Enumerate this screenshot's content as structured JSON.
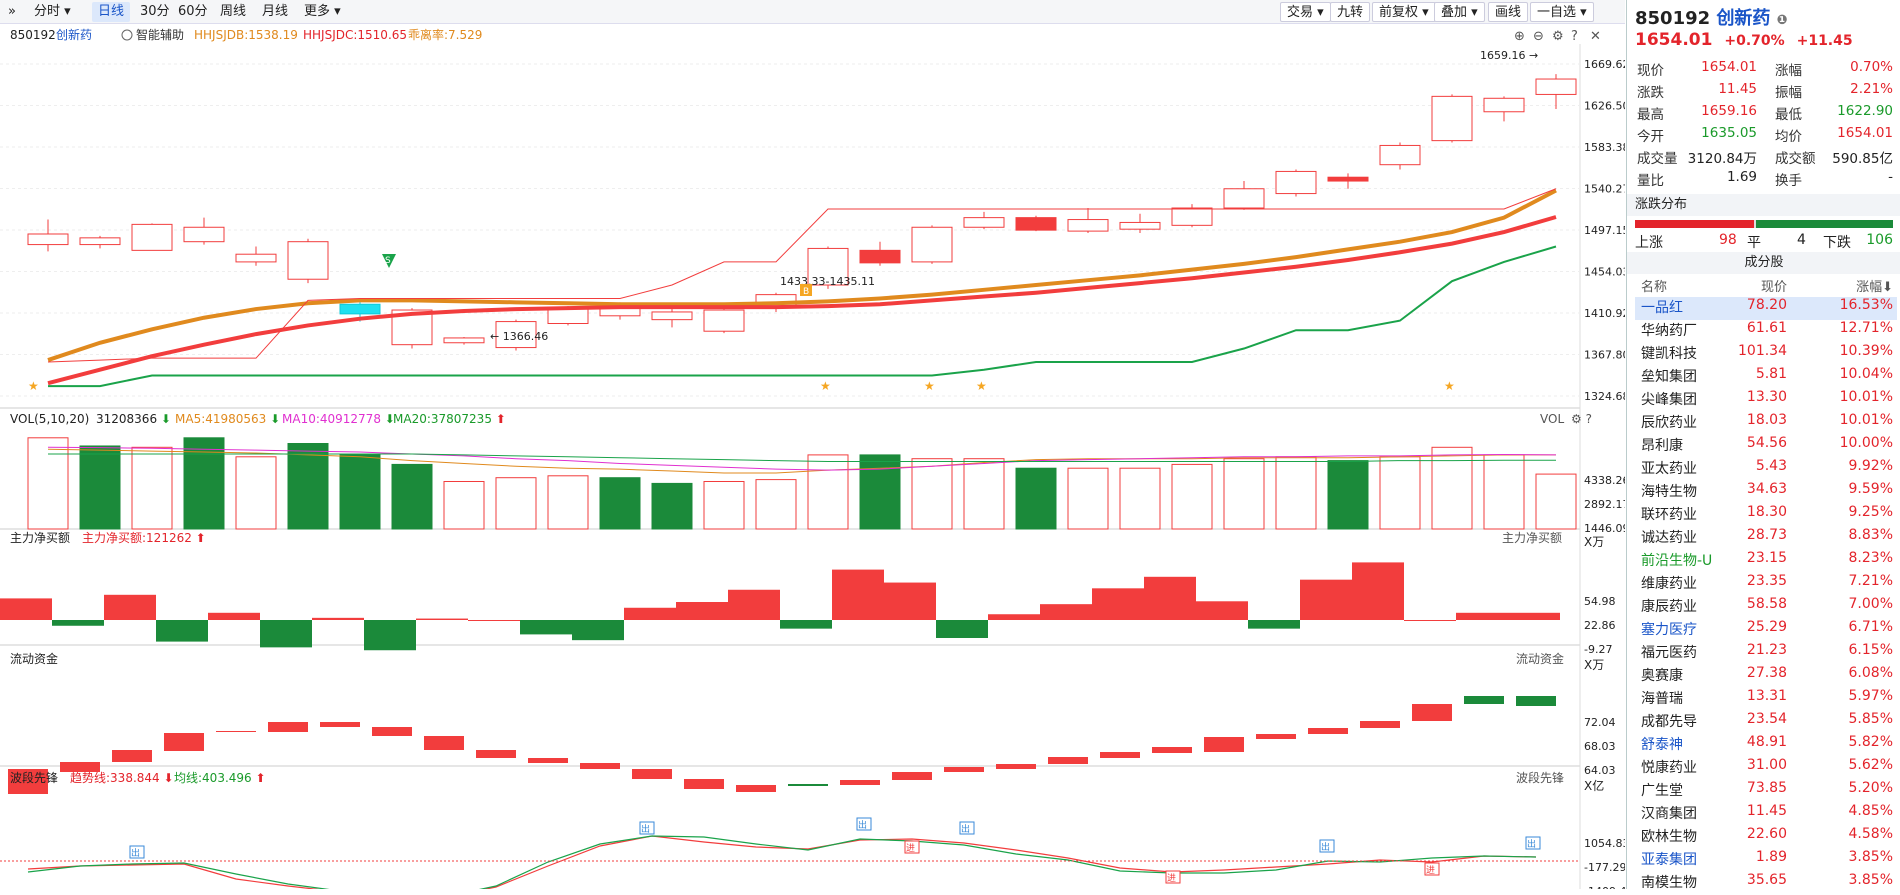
{
  "toolbar": {
    "items": [
      "»",
      "分时",
      "日线",
      "30分",
      "60分",
      "周线",
      "月线",
      "更多"
    ],
    "right": [
      "交易",
      "九转",
      "前复权",
      "叠加",
      "画线",
      "一自选"
    ]
  },
  "chart": {
    "code": "850192",
    "name": "创新药",
    "assist": "智能辅助",
    "ind1": "HHJSJDB:1538.19",
    "ind2": "HHJSJDC:1510.65",
    "ind3": "乖离率:7.529",
    "price_axis": [
      "1669.62",
      "1626.50",
      "1583.38",
      "1540.27",
      "1497.15",
      "1454.03",
      "1410.92",
      "1367.80",
      "1324.68"
    ],
    "annot_high": "1659.16",
    "annot_low": "1366.46",
    "annot_mid": "1433.33-1435.11"
  },
  "vol": {
    "title": "VOL(5,10,20)",
    "v": "31208366",
    "ma5": "MA5:41980563",
    "ma10": "MA10:40912778",
    "ma20": "MA20:37807235",
    "right": "VOL",
    "axis": [
      "4338.26",
      "2892.17",
      "1446.09"
    ],
    "unit": "X万"
  },
  "zl": {
    "title": "主力净买额",
    "val": "主力净买额:121262",
    "right": "主力净买额",
    "axis": [
      "54.98",
      "22.86",
      "-9.27"
    ],
    "unit": "X万"
  },
  "ld": {
    "title": "流动资金",
    "right": "流动资金",
    "axis": [
      "72.04",
      "68.03",
      "64.03"
    ],
    "unit": "X亿"
  },
  "bd": {
    "title": "波段先锋",
    "trend": "趋势线:338.844",
    "avg": "均线:403.496",
    "right": "波段先锋",
    "axis": [
      "1054.83",
      "-177.29",
      "-1409.40"
    ],
    "in": "进",
    "out": "出"
  },
  "quote": {
    "code": "850192",
    "name": "创新药",
    "price": "1654.01",
    "pct": "+0.70%",
    "chg": "+11.45",
    "rows": [
      [
        "现价",
        "1654.01",
        "涨幅",
        "0.70%"
      ],
      [
        "涨跌",
        "11.45",
        "振幅",
        "2.21%"
      ],
      [
        "最高",
        "1659.16",
        "最低",
        "1622.90"
      ],
      [
        "今开",
        "1635.05",
        "均价",
        "1654.01"
      ],
      [
        "成交量",
        "3120.84万",
        "成交额",
        "590.85亿"
      ],
      [
        "量比",
        "1.69",
        "换手",
        "-"
      ]
    ],
    "dist_title": "涨跌分布",
    "up_label": "上涨",
    "up": "98",
    "flat_label": "平",
    "flat": "4",
    "down_label": "下跌",
    "down": "106",
    "cf_title": "成分股",
    "col_name": "名称",
    "col_price": "现价",
    "col_pct": "涨幅"
  },
  "stocks": [
    [
      "一品红",
      "78.20",
      "16.53%"
    ],
    [
      "华纳药厂",
      "61.61",
      "12.71%"
    ],
    [
      "键凯科技",
      "101.34",
      "10.39%"
    ],
    [
      "垒知集团",
      "5.81",
      "10.04%"
    ],
    [
      "尖峰集团",
      "13.30",
      "10.01%"
    ],
    [
      "辰欣药业",
      "18.03",
      "10.01%"
    ],
    [
      "昂利康",
      "54.56",
      "10.00%"
    ],
    [
      "亚太药业",
      "5.43",
      "9.92%"
    ],
    [
      "海特生物",
      "34.63",
      "9.59%"
    ],
    [
      "联环药业",
      "18.30",
      "9.25%"
    ],
    [
      "诚达药业",
      "28.73",
      "8.83%"
    ],
    [
      "前沿生物-U",
      "23.15",
      "8.23%"
    ],
    [
      "维康药业",
      "23.35",
      "7.21%"
    ],
    [
      "康辰药业",
      "58.58",
      "7.00%"
    ],
    [
      "塞力医疗",
      "25.29",
      "6.71%"
    ],
    [
      "福元医药",
      "21.23",
      "6.15%"
    ],
    [
      "奥赛康",
      "27.38",
      "6.08%"
    ],
    [
      "海普瑞",
      "13.31",
      "5.97%"
    ],
    [
      "成都先导",
      "23.54",
      "5.85%"
    ],
    [
      "舒泰神",
      "48.91",
      "5.82%"
    ],
    [
      "悦康药业",
      "31.00",
      "5.62%"
    ],
    [
      "广生堂",
      "73.85",
      "5.20%"
    ],
    [
      "汉商集团",
      "11.45",
      "4.85%"
    ],
    [
      "欧林生物",
      "22.60",
      "4.58%"
    ],
    [
      "亚泰集团",
      "1.89",
      "3.85%"
    ],
    [
      "南模生物",
      "35.65",
      "3.85%"
    ]
  ],
  "colors": {
    "up": "#f23d3d",
    "down": "#1b8a3a",
    "cyan": "#1ee0f0",
    "orange": "#e08a1e",
    "ma10": "#e030d0"
  }
}
